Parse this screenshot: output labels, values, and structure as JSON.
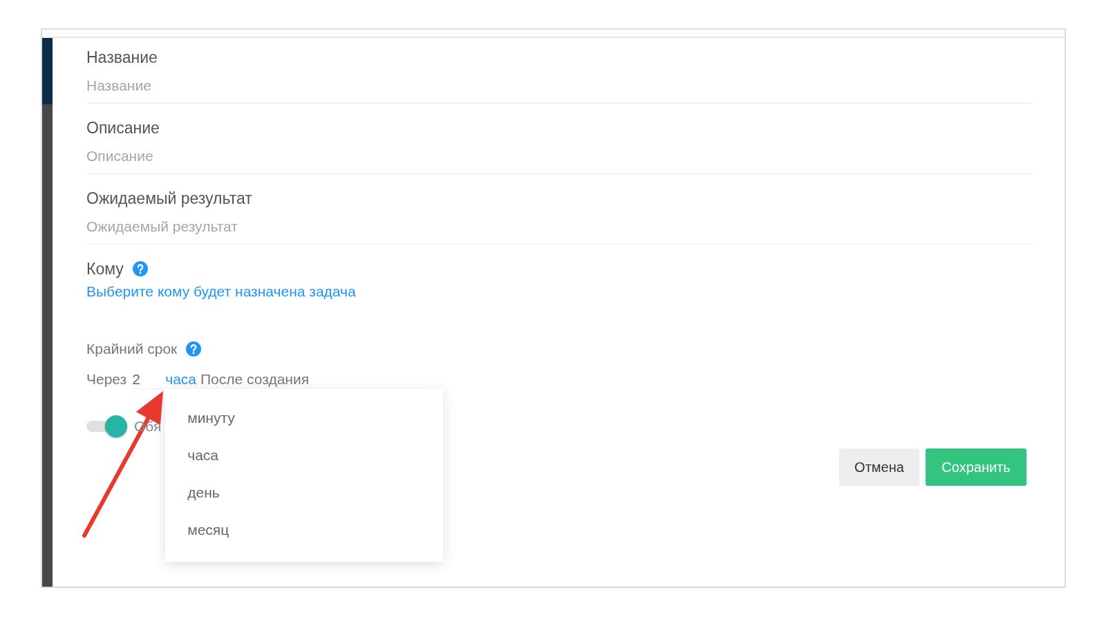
{
  "form": {
    "fields": [
      {
        "label": "Название",
        "placeholder": "Название"
      },
      {
        "label": "Описание",
        "placeholder": "Описание"
      },
      {
        "label": "Ожидаемый результат",
        "placeholder": "Ожидаемый результат"
      }
    ],
    "assignee": {
      "label": "Кому",
      "link": "Выберите кому будет назначена задача"
    },
    "deadline": {
      "label": "Крайний срок",
      "prefix": "Через",
      "amount": "2",
      "unit": "часа",
      "suffix": "После создания",
      "unit_menu": [
        "минуту",
        "часа",
        "день",
        "месяц"
      ]
    },
    "required_toggle": {
      "on": true,
      "label": "Обя"
    },
    "buttons": [
      {
        "label": "Отмена",
        "kind": "secondary"
      },
      {
        "label": "Сохранить",
        "kind": "primary"
      }
    ]
  }
}
